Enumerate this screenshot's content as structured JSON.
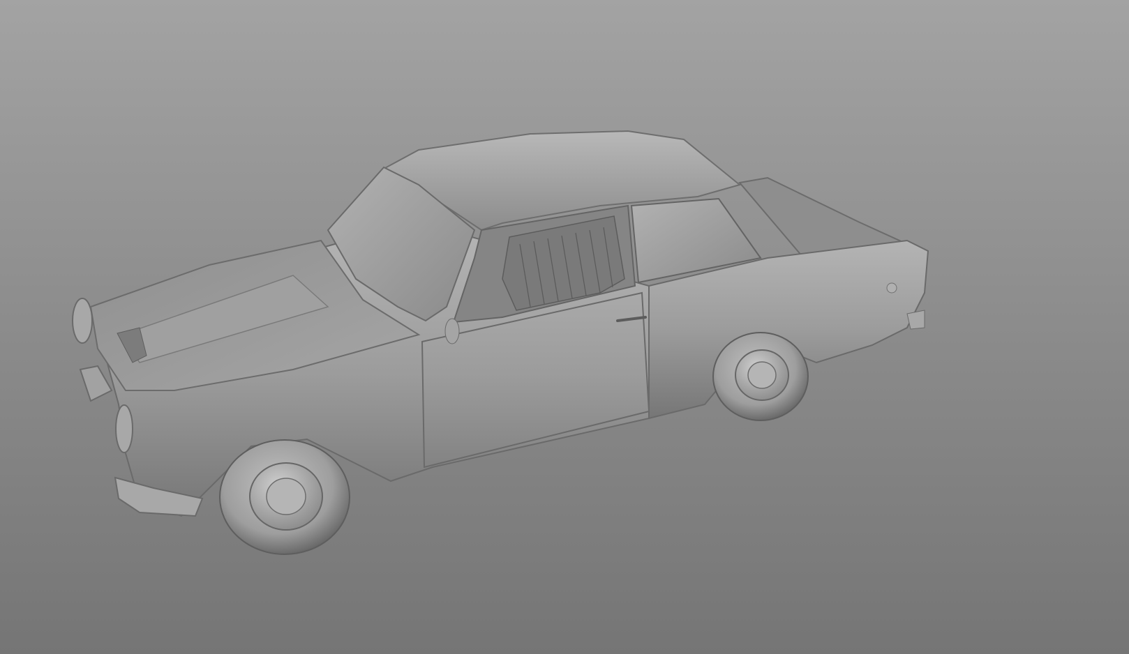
{
  "viewport": {
    "background_top": "#a3a3a3",
    "background_bottom": "#757575"
  },
  "model": {
    "subject": "car-3d-model",
    "shading": "clay-grey",
    "body_color": "#9a9a9a",
    "highlight_color": "#c8c8c8",
    "shadow_color": "#5e5e5e"
  }
}
